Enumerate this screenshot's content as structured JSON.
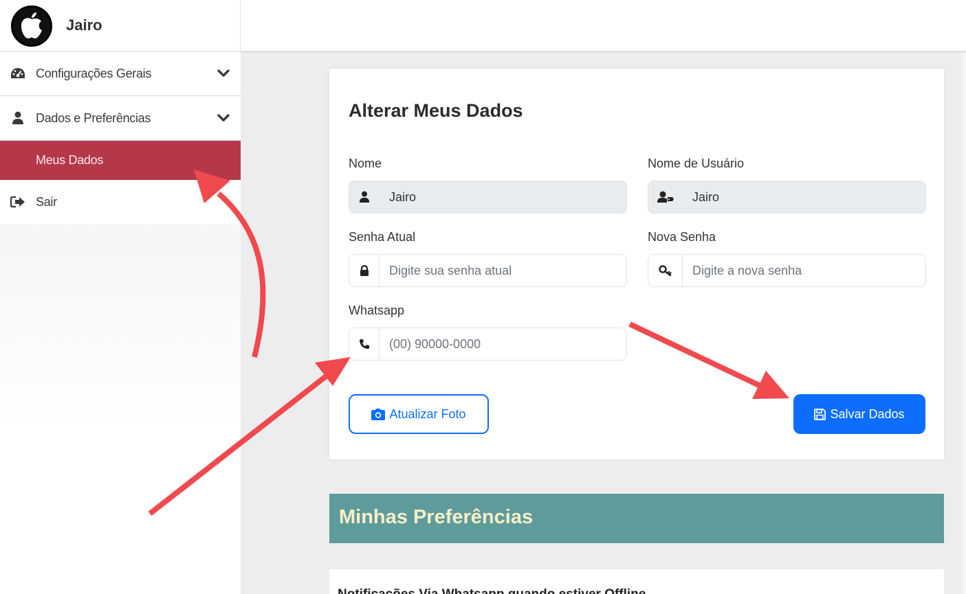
{
  "header": {
    "user_name": "Jairo",
    "logo_icon": "apple-logo-icon"
  },
  "sidebar": {
    "items": [
      {
        "label": "Configurações Gerais",
        "icon": "dashboard-gauge-icon",
        "expandable": true
      },
      {
        "label": "Dados e Preferências",
        "icon": "user-icon",
        "expandable": true
      },
      {
        "label": "Meus Dados",
        "active": true
      },
      {
        "label": "Sair",
        "icon": "sign-out-icon"
      }
    ]
  },
  "form": {
    "title": "Alterar Meus Dados",
    "nome": {
      "label": "Nome",
      "value": "Jairo",
      "icon": "user-icon"
    },
    "usuario": {
      "label": "Nome de Usuário",
      "value": "Jairo",
      "icon": "user-tag-icon"
    },
    "senha_atual": {
      "label": "Senha Atual",
      "placeholder": "Digite sua senha atual",
      "icon": "lock-icon"
    },
    "nova_senha": {
      "label": "Nova Senha",
      "placeholder": "Digite a nova senha",
      "icon": "key-icon"
    },
    "whatsapp": {
      "label": "Whatsapp",
      "placeholder": "(00) 90000-0000",
      "icon": "phone-icon"
    },
    "btn_foto": "Atualizar Foto",
    "btn_salvar": "Salvar Dados"
  },
  "preferences": {
    "title": "Minhas Preferências",
    "first_item_partial": "Notificações Via Whatsapp quando estiver Offline"
  },
  "colors": {
    "active_menu": "#b5384a",
    "primary": "#0d6efd",
    "pref_banner": "#5f9b9a",
    "annotation_arrow": "#f0494e"
  }
}
